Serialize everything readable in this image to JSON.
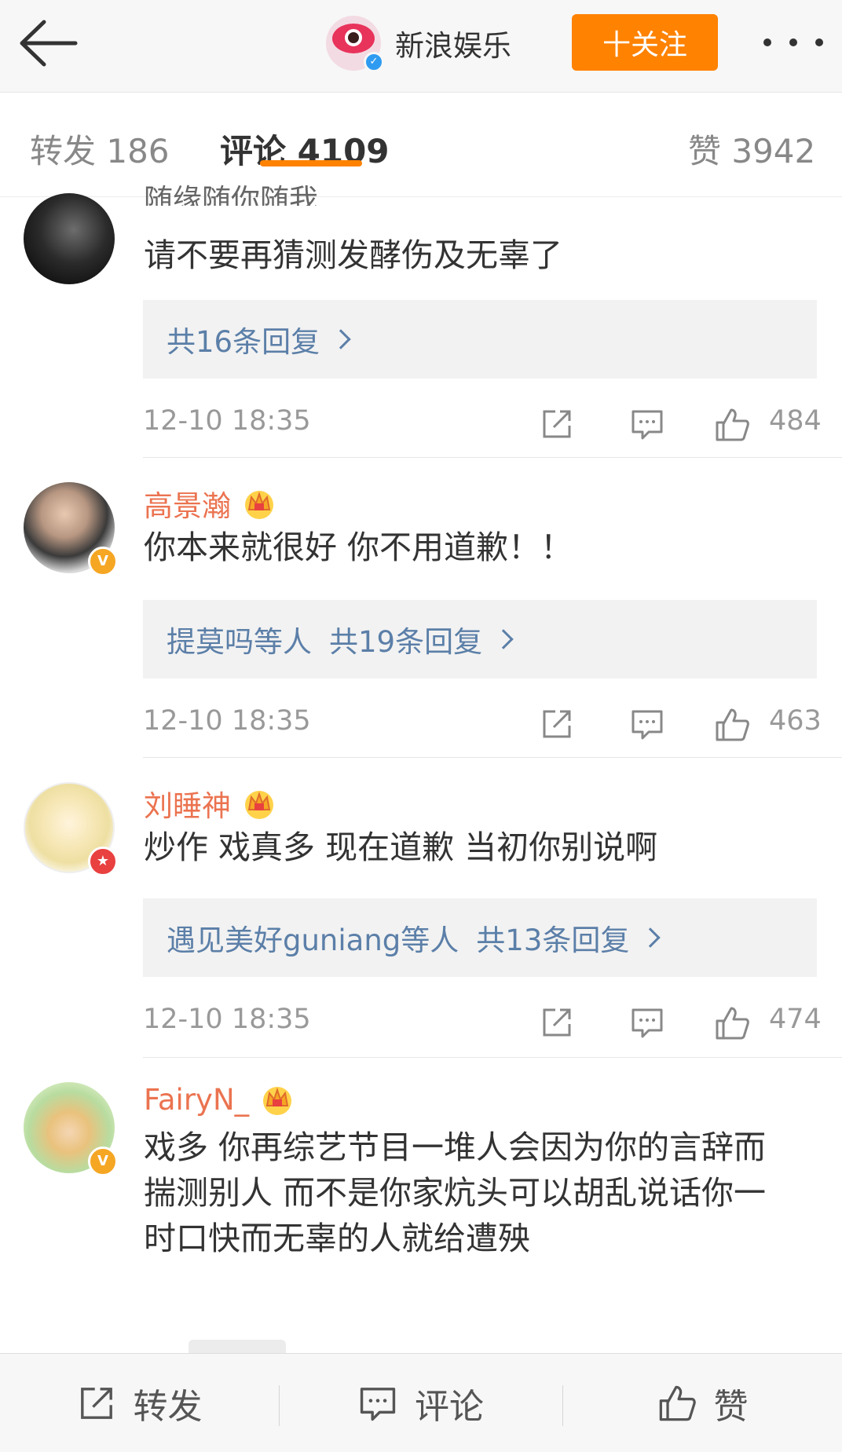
{
  "header": {
    "back_icon": "back-arrow-icon",
    "account_name": "新浪娱乐",
    "follow_label": "十关注",
    "more_icon": "more-dots-icon"
  },
  "tabs": [
    {
      "label": "转发 186"
    },
    {
      "label": "评论 4109",
      "active": true
    },
    {
      "label": "赞 3942"
    }
  ],
  "comments": [
    {
      "username": "随缘随你随我",
      "text": "请不要再猜测发酵伤及无辜了",
      "replies": {
        "prefix": "",
        "label": "共16条回复"
      },
      "time": "12-10 18:35",
      "likes": "484"
    },
    {
      "username": "高景瀚",
      "badge": "V",
      "text": "你本来就很好 你不用道歉！！",
      "replies": {
        "prefix": "提莫吗等人",
        "label": "共19条回复"
      },
      "time": "12-10 18:35",
      "likes": "463"
    },
    {
      "username": "刘睡神",
      "badge": "★",
      "text": "炒作 戏真多 现在道歉 当初你别说啊",
      "replies": {
        "prefix": "遇见美好guniang等人",
        "label": "共13条回复"
      },
      "time": "12-10 18:35",
      "likes": "474"
    },
    {
      "username": "FairyN_",
      "badge": "V",
      "text": "戏多 你再综艺节目一堆人会因为你的言辞而揣测别人 而不是你家炕头可以胡乱说话你一时口快而无辜的人就给遭殃"
    }
  ],
  "bottom_bar": {
    "repost_label": "转发",
    "comment_label": "评论",
    "like_label": "赞"
  },
  "colors": {
    "accent": "#ff8200",
    "username": "#eb7350",
    "reply_link": "#5b7fa8"
  }
}
